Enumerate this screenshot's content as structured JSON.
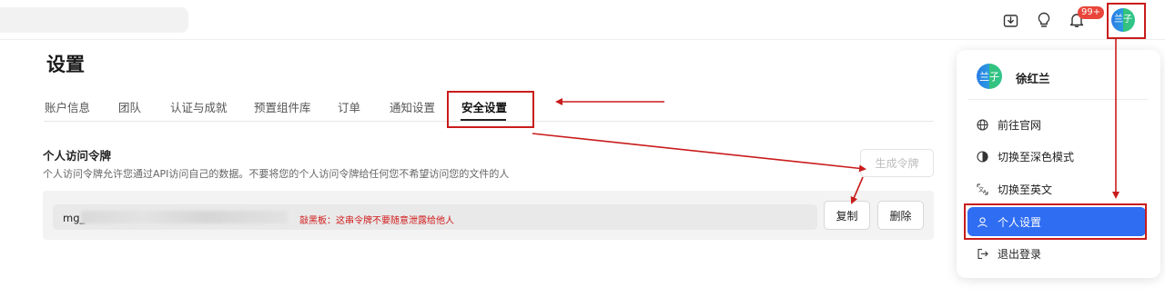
{
  "header": {
    "notification_badge": "99+",
    "avatar_text": "兰子",
    "icons": [
      "download-icon",
      "lightbulb-icon",
      "bell-icon"
    ]
  },
  "page": {
    "title": "设置",
    "tabs": [
      {
        "label": "账户信息"
      },
      {
        "label": "团队"
      },
      {
        "label": "认证与成就"
      },
      {
        "label": "预置组件库"
      },
      {
        "label": "订单"
      },
      {
        "label": "通知设置"
      },
      {
        "label": "安全设置",
        "active": true
      }
    ]
  },
  "token_section": {
    "title": "个人访问令牌",
    "description": "个人访问令牌允许您通过API访问自己的数据。不要将您的个人访问令牌给任何您不希望访问您的文件的人",
    "generate_button": "生成令牌",
    "token_prefix": "mg_",
    "warning": "敲黑板：这串令牌不要随意泄露给他人",
    "copy_button": "复制",
    "delete_button": "删除"
  },
  "user_menu": {
    "avatar_text": "兰子",
    "user_name": "徐红兰",
    "items": [
      {
        "label": "前往官网",
        "icon": "globe-icon"
      },
      {
        "label": "切换至深色模式",
        "icon": "half-circle-icon"
      },
      {
        "label": "切换至英文",
        "icon": "translate-icon"
      },
      {
        "label": "个人设置",
        "icon": "user-icon",
        "active": true
      },
      {
        "label": "退出登录",
        "icon": "logout-icon"
      }
    ]
  },
  "colors": {
    "accent": "#2f6df2",
    "annotation_red": "#c91c1c",
    "badge_red": "#e8463b",
    "warning_text": "#d11a1a"
  }
}
